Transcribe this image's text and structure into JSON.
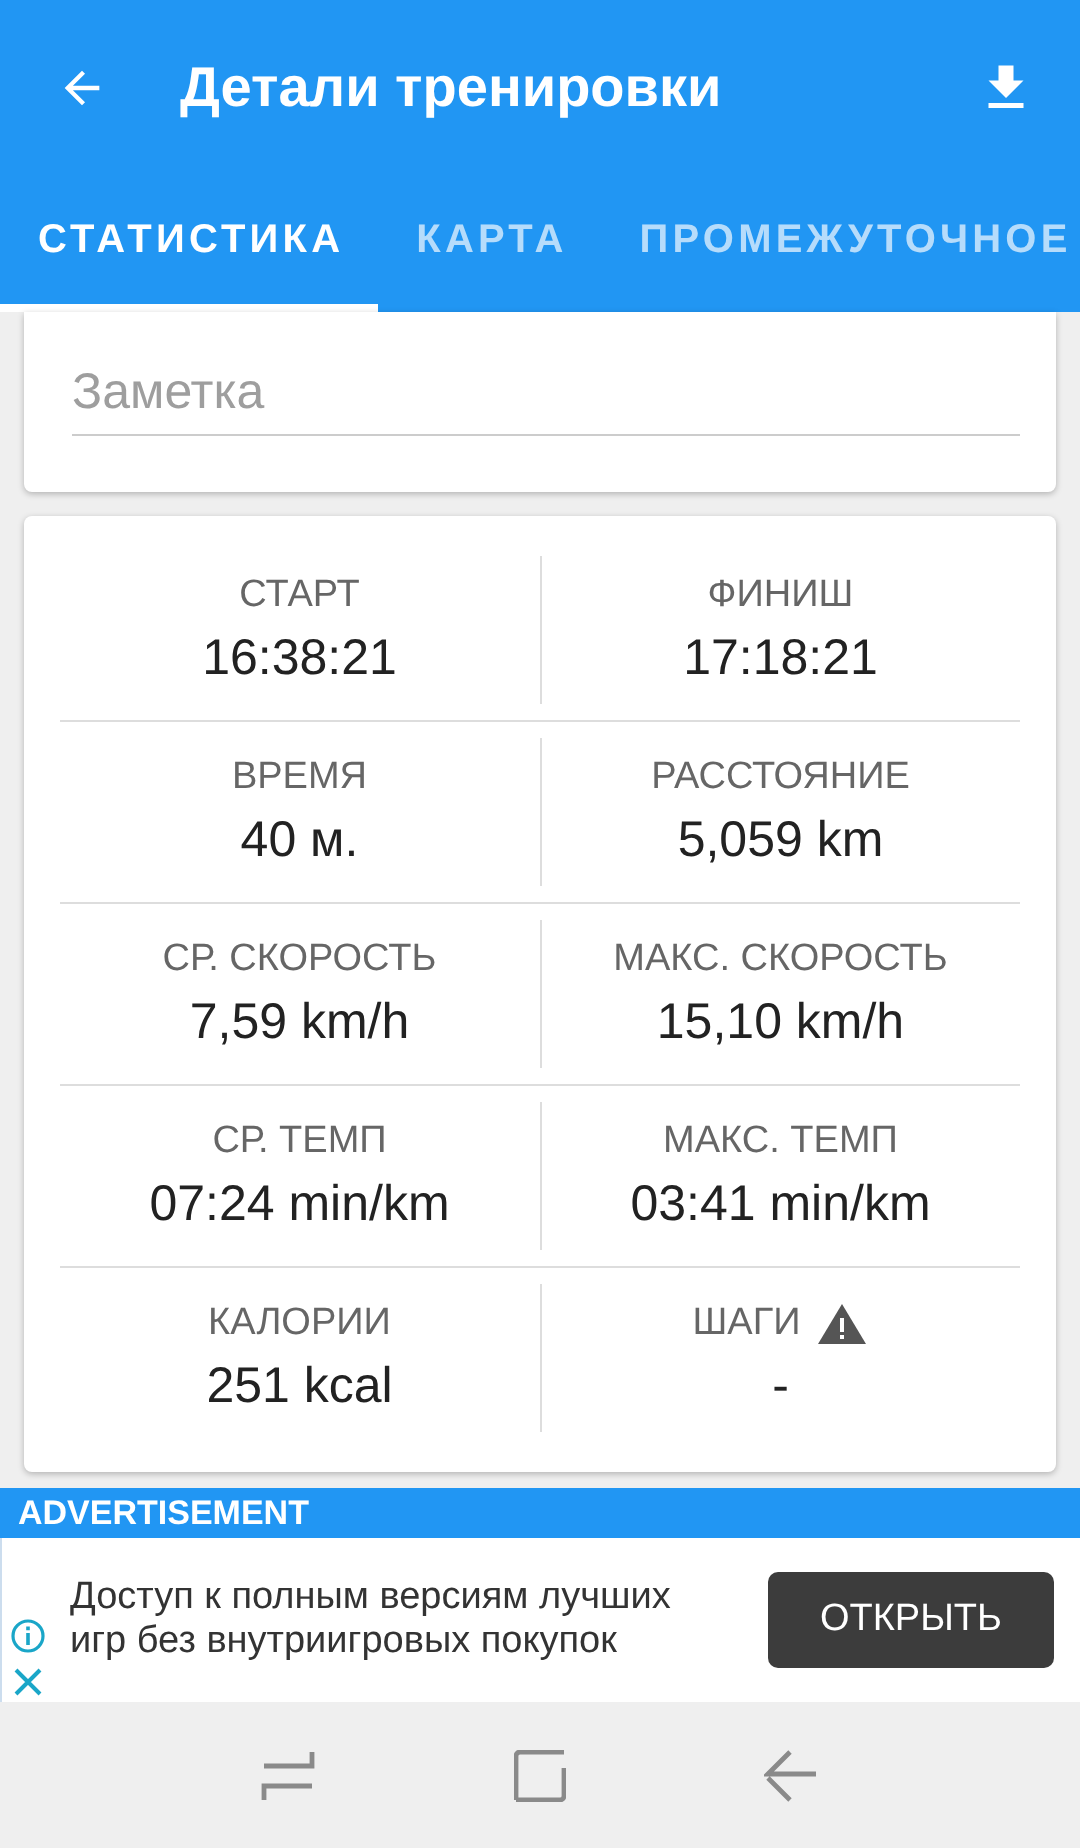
{
  "app_bar": {
    "title": "Детали тренировки"
  },
  "tabs": [
    {
      "label": "СТАТИСТИКА",
      "selected": true
    },
    {
      "label": "КАРТА",
      "selected": false
    },
    {
      "label": "ПРОМЕЖУТОЧНОЕ",
      "selected": false
    }
  ],
  "note": {
    "placeholder": "Заметка"
  },
  "stats": [
    [
      {
        "label": "СТАРТ",
        "value": "16:38:21",
        "warning": false
      },
      {
        "label": "ФИНИШ",
        "value": "17:18:21",
        "warning": false
      }
    ],
    [
      {
        "label": "ВРЕМЯ",
        "value": "40 м.",
        "warning": false
      },
      {
        "label": "РАССТОЯНИЕ",
        "value": "5,059 km",
        "warning": false
      }
    ],
    [
      {
        "label": "СР. СКОРОСТЬ",
        "value": "7,59 km/h",
        "warning": false
      },
      {
        "label": "МАКС. СКОРОСТЬ",
        "value": "15,10 km/h",
        "warning": false
      }
    ],
    [
      {
        "label": "СР. ТЕМП",
        "value": "07:24 min/km",
        "warning": false
      },
      {
        "label": "МАКС. ТЕМП",
        "value": "03:41 min/km",
        "warning": false
      }
    ],
    [
      {
        "label": "КАЛОРИИ",
        "value": "251 kcal",
        "warning": false
      },
      {
        "label": "ШАГИ",
        "value": "-",
        "warning": true
      }
    ]
  ],
  "ad": {
    "label": "ADVERTISEMENT",
    "text": "Доступ к полным версиям лучших игр без внутриигровых покупок",
    "button": "ОТКРЫТЬ"
  }
}
